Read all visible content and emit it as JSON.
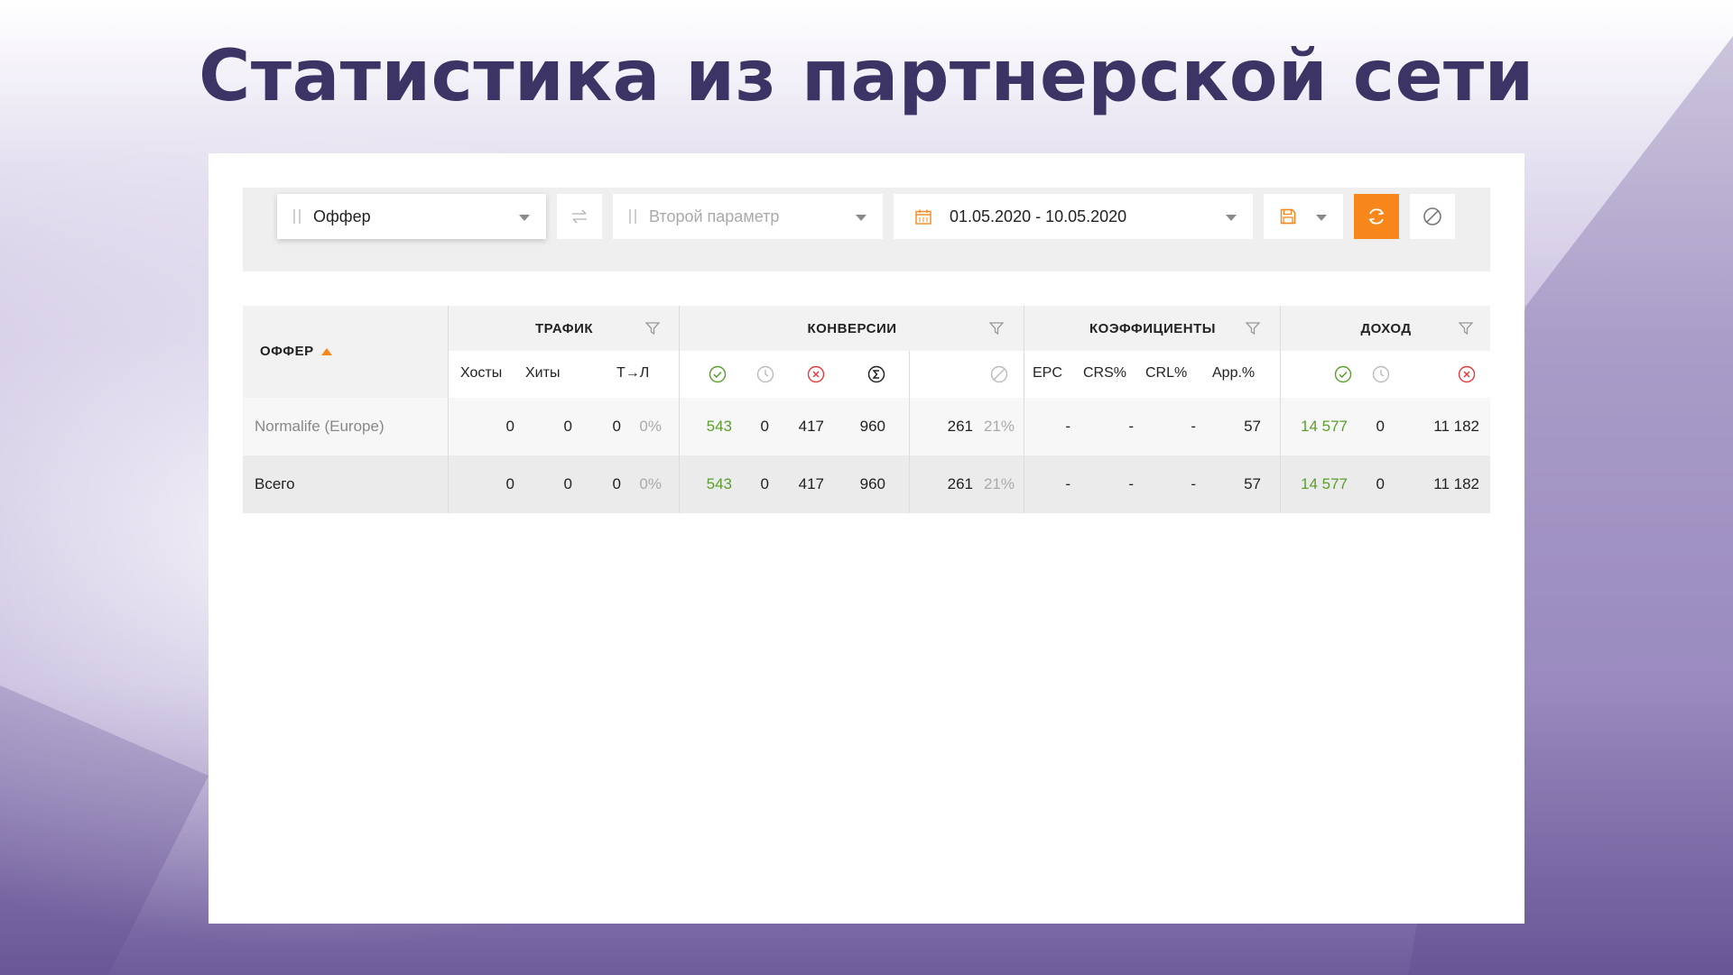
{
  "slide": {
    "title": "Статистика из партнерской сети"
  },
  "toolbar": {
    "first_param": "Оффер",
    "second_param_placeholder": "Второй параметр",
    "date_range": "01.05.2020 - 10.05.2020",
    "accent_color": "#f7871b"
  },
  "table": {
    "offer_header": "ОФФЕР",
    "groups": {
      "traffic": "ТРАФИК",
      "conversions": "КОНВЕРСИИ",
      "coefficients": "КОЭФФИЦИЕНТЫ",
      "income": "ДОХОД"
    },
    "subheaders": {
      "hosts": "Хосты",
      "hits": "Хиты",
      "t_to_l": "Т→Л",
      "epc": "EPC",
      "crs": "CRS%",
      "crl": "CRL%",
      "app": "App.%"
    },
    "rows": [
      {
        "name": "Normalife (Europe)",
        "hosts": "0",
        "hits": "0",
        "tl": "0",
        "tl_pct": "0%",
        "approved": "543",
        "pending": "0",
        "rejected": "417",
        "total": "960",
        "trash": "261",
        "trash_pct": "21%",
        "epc": "-",
        "crs": "-",
        "crl": "-",
        "app": "57",
        "inc_approved": "14 577",
        "inc_pending": "0",
        "inc_rejected": "11 182"
      },
      {
        "name": "Всего",
        "hosts": "0",
        "hits": "0",
        "tl": "0",
        "tl_pct": "0%",
        "approved": "543",
        "pending": "0",
        "rejected": "417",
        "total": "960",
        "trash": "261",
        "trash_pct": "21%",
        "epc": "-",
        "crs": "-",
        "crl": "-",
        "app": "57",
        "inc_approved": "14 577",
        "inc_pending": "0",
        "inc_rejected": "11 182"
      }
    ]
  }
}
